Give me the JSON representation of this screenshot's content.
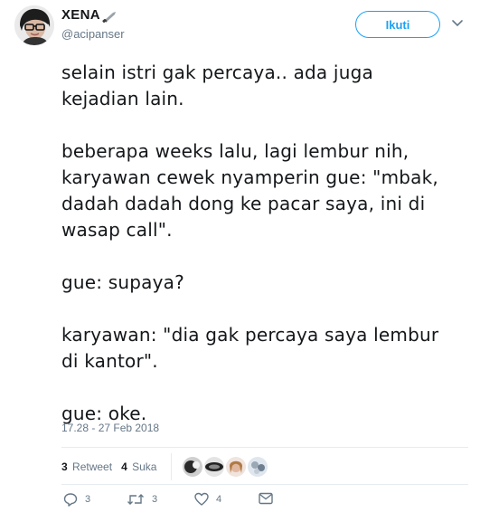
{
  "author": {
    "display_name": "XENA",
    "name_emoji": "knife-emoji",
    "handle": "@acipanser",
    "avatar_icon": "avatar"
  },
  "follow_button_label": "Ikuti",
  "tweet": {
    "paragraphs": [
      "selain istri gak percaya.. ada juga\nkejadian lain.",
      "beberapa weeks lalu, lagi lembur nih,\nkaryawan cewek nyamperin gue: \"mbak,\ndadah dadah dong ke pacar saya, ini di\nwasap call\".",
      "gue: supaya?",
      "karyawan: \"dia gak percaya saya lembur\ndi kantor\".",
      "gue: oke."
    ]
  },
  "timestamp": "17.28 - 27 Feb 2018",
  "stats": {
    "retweets_count": "3",
    "retweets_label": "Retweet",
    "likes_count": "4",
    "likes_label": "Suka"
  },
  "actions": {
    "reply_count": "3",
    "retweet_count": "3",
    "like_count": "4"
  },
  "colors": {
    "accent": "#1da1f2",
    "text": "#14171a",
    "secondary": "#657786",
    "divider": "#e6ecf0"
  }
}
